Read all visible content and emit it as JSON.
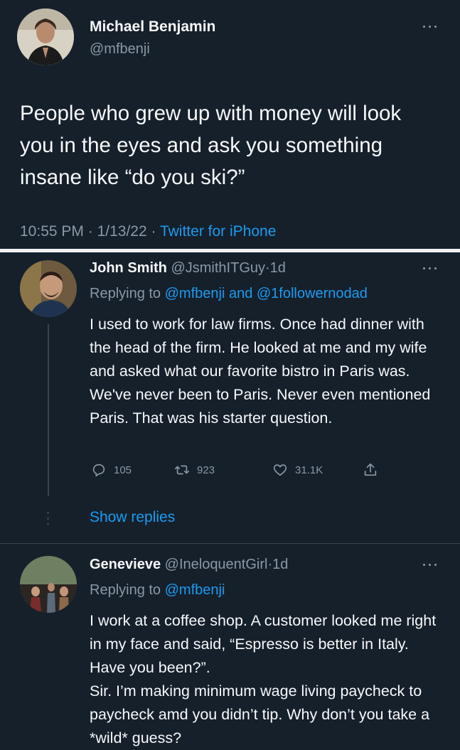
{
  "main_tweet": {
    "author_name": "Michael Benjamin",
    "author_handle": "@mfbenji",
    "text": "People who grew up with money will look you in the eyes and ask you something  insane like “do you ski?”",
    "time": "10:55 PM",
    "date": "1/13/22",
    "source": "Twitter for iPhone",
    "separator": "·"
  },
  "replies": [
    {
      "author_name": "John Smith",
      "author_handle": "@JsmithITGuy",
      "age": "1d",
      "replying_prefix": "Replying to",
      "replying_to": "@mfbenji and @1followernodad",
      "text": "I used to work for law firms. Once had dinner with the head of the firm. He looked at me and my wife and asked what our favorite bistro in Paris was. We've never been to Paris. Never even mentioned Paris. That was his starter question.",
      "reply_count": "105",
      "retweet_count": "923",
      "like_count": "31.1K",
      "show_replies_label": "Show replies"
    },
    {
      "author_name": "Genevieve",
      "author_handle": "@IneloquentGirl",
      "age": "1d",
      "replying_prefix": "Replying to",
      "replying_to": "@mfbenji",
      "text": "I work at a coffee shop. A customer looked me right in my face and said, “Espresso is better in Italy. Have you been?”.\nSir. I’m making minimum wage living paycheck to paycheck amd you didn’t tip. Why don’t you take a *wild* guess?"
    }
  ],
  "colors": {
    "background": "#15202b",
    "text": "#f7f9f9",
    "muted": "#8b98a5",
    "accent": "#1d9bf0",
    "divider": "#38444d"
  },
  "icons": [
    "more-icon",
    "reply-icon",
    "retweet-icon",
    "like-icon",
    "share-icon"
  ]
}
